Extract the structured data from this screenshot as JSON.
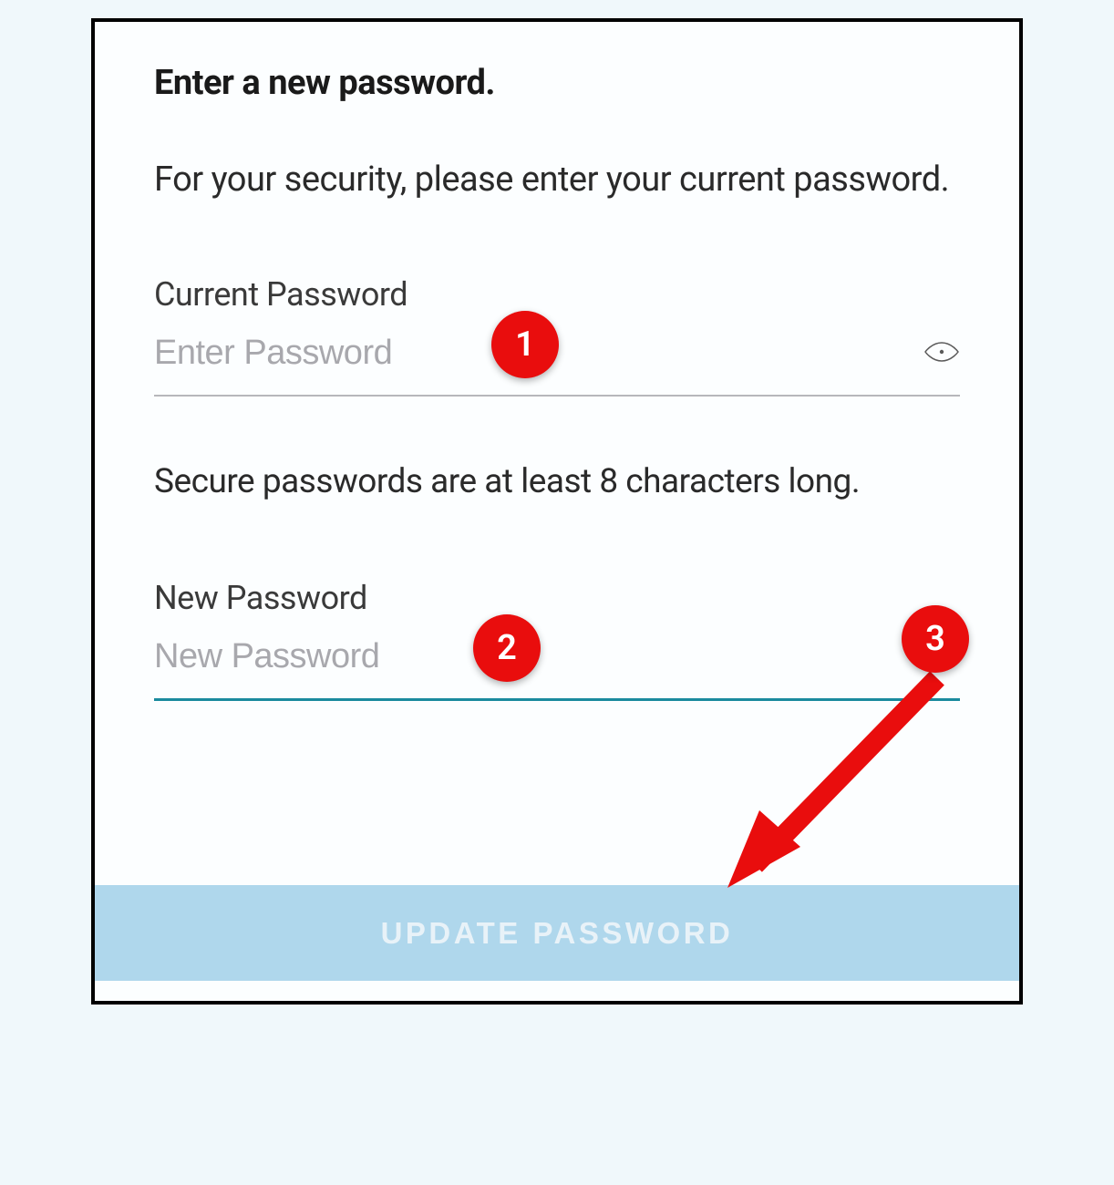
{
  "form": {
    "title": "Enter a new password.",
    "subtitle": "For your security, please enter your current password.",
    "current_password": {
      "label": "Current Password",
      "placeholder": "Enter Password"
    },
    "hint": "Secure passwords are at least 8 characters long.",
    "new_password": {
      "label": "New Password",
      "placeholder": "New Password"
    },
    "submit_label": "UPDATE PASSWORD"
  },
  "annotations": {
    "marker1": "1",
    "marker2": "2",
    "marker3": "3"
  }
}
